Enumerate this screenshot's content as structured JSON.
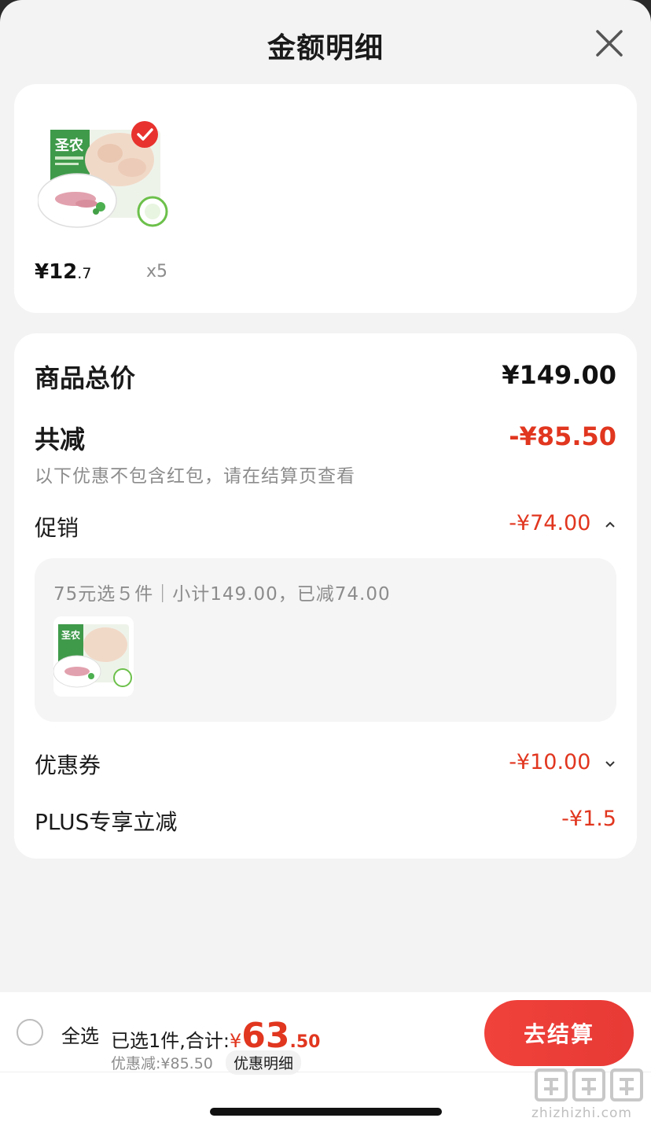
{
  "header": {
    "title": "金额明细"
  },
  "products": [
    {
      "price_int": "¥12",
      "price_dec": ".7",
      "quantity": "x5",
      "selected": true,
      "pack_brand": "圣农"
    }
  ],
  "details": {
    "total_label": "商品总价",
    "total_value": "¥149.00",
    "reduce_label": "共减",
    "reduce_value": "-¥85.50",
    "reduce_note": "以下优惠不包含红包，请在结算页查看",
    "promo_label": "促销",
    "promo_value": "-¥74.00",
    "promo_desc": "75元选５件｜小计149.00，已减74.00",
    "coupon_label": "优惠券",
    "coupon_value": "-¥10.00",
    "plus_label": "PLUS专享立减",
    "plus_value": "-¥1.5"
  },
  "bottom": {
    "select_all": "全选",
    "summary_prefix": "已选1件,合计:",
    "currency": "¥",
    "total_int": "63",
    "total_dec": ".50",
    "discount_text": "优惠减:¥85.50",
    "detail_chip": "优惠明细",
    "checkout_label": "去结算"
  },
  "watermark": {
    "text": "zhizhizhi.com"
  },
  "colors": {
    "accent": "#e1361f",
    "checkout": "#ee3d38",
    "background": "#f3f3f3"
  }
}
